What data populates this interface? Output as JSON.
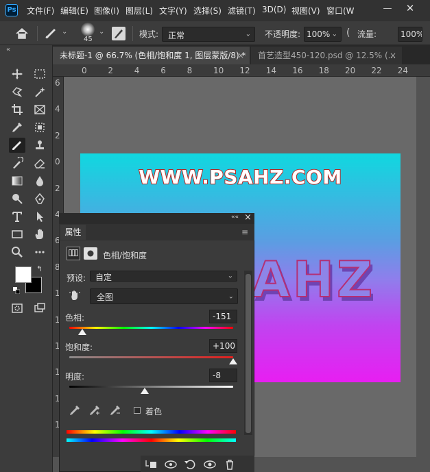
{
  "app": {
    "logo_text": "Ps"
  },
  "menu": {
    "items": [
      "文件(F)",
      "编辑(E)",
      "图像(I)",
      "图层(L)",
      "文字(Y)",
      "选择(S)",
      "滤镜(T)",
      "3D(D)",
      "视图(V)",
      "窗口(W"
    ]
  },
  "window": {
    "minimize": "—",
    "close": "✕"
  },
  "options": {
    "brush_size": "45",
    "mode_label": "模式:",
    "mode_value": "正常",
    "opacity_label": "不透明度:",
    "opacity_value": "100%",
    "flow_label": "流量:",
    "flow_value": "100%"
  },
  "tabs": [
    {
      "label": "未标题-1 @ 66.7% (色相/饱和度 1, 图层蒙版/8) *",
      "close": "×"
    },
    {
      "label": "首艺造型450-120.psd @ 12.5% (...",
      "close": "×"
    }
  ],
  "rulers": {
    "h_ticks": [
      "0",
      "2",
      "4",
      "6",
      "8",
      "10",
      "12",
      "14",
      "16",
      "18",
      "20",
      "22",
      "24"
    ],
    "v_ticks": [
      "6",
      "4",
      "2",
      "0",
      "2",
      "4",
      "6",
      "8",
      "1",
      "1",
      "1",
      "1",
      "1",
      "1"
    ]
  },
  "canvas": {
    "headline": "WWW.PSAHZ.COM",
    "logo_text": "AHZ"
  },
  "properties": {
    "tab_label": "属性",
    "adjustment_title": "色相/饱和度",
    "preset_label": "预设:",
    "preset_value": "自定",
    "channel_value": "全图",
    "hue_label": "色相:",
    "hue_value": "-151",
    "saturation_label": "饱和度:",
    "saturation_value": "+100",
    "lightness_label": "明度:",
    "lightness_value": "-8",
    "colorize_label": "着色",
    "collapse_icon": "««",
    "close_icon": "×"
  },
  "adjust": {
    "hue": -151,
    "saturation": 100,
    "lightness": -8
  }
}
